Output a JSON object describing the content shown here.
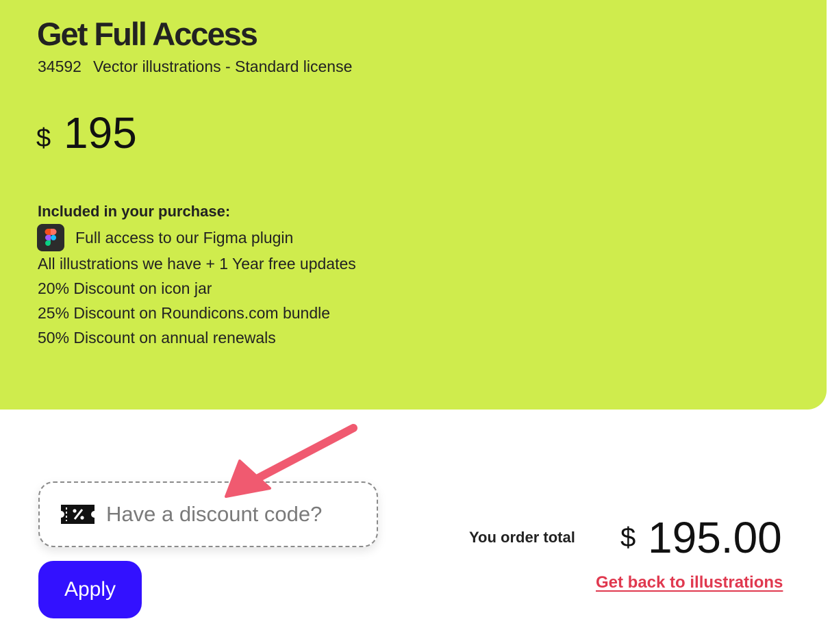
{
  "hero": {
    "title": "Get Full Access",
    "count": "34592",
    "license": "Vector illustrations - Standard license",
    "price_currency": "$",
    "price_amount": "195",
    "background_color": "#cfec4d"
  },
  "included": {
    "heading": "Included in your purchase:",
    "items": [
      {
        "label": "Full access to our Figma plugin",
        "icon": "figma-icon"
      },
      {
        "label": "All illustrations we have + 1 Year free updates"
      },
      {
        "label": "20% Discount on icon jar"
      },
      {
        "label": "25% Discount on Roundicons.com bundle"
      },
      {
        "label": "50% Discount on annual renewals"
      }
    ]
  },
  "discount": {
    "icon": "ticket-percent-icon",
    "placeholder": "Have a discount code?",
    "value": "",
    "apply_label": "Apply",
    "apply_color": "#3311ff"
  },
  "annotation": {
    "icon": "pointer-arrow-icon",
    "color": "#f05a70"
  },
  "order": {
    "total_label": "You order total",
    "currency": "$",
    "amount": "195.00",
    "back_link_label": "Get back to illustrations",
    "link_color": "#e0394f"
  }
}
